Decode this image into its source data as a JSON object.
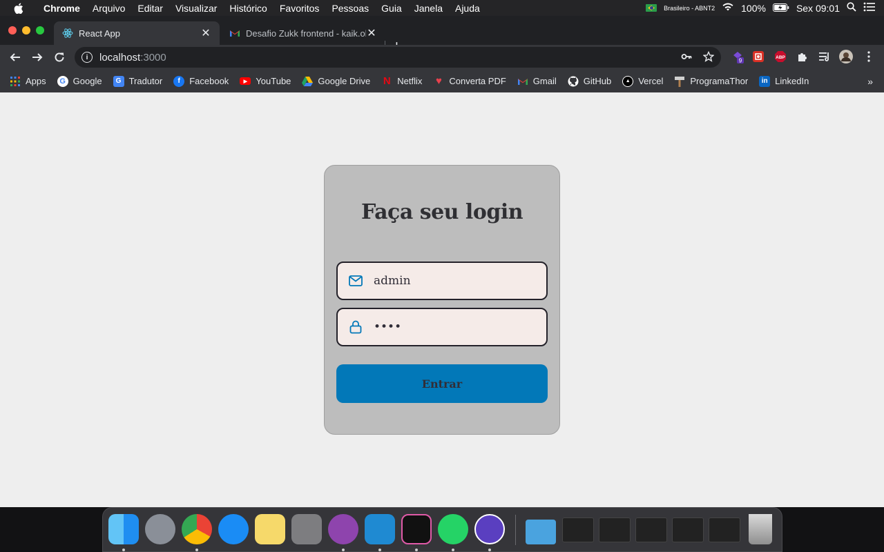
{
  "menubar": {
    "app": "Chrome",
    "items": [
      "Arquivo",
      "Editar",
      "Visualizar",
      "Histórico",
      "Favoritos",
      "Pessoas",
      "Guia",
      "Janela",
      "Ajuda"
    ],
    "keyboard": "Brasileiro - ABNT2",
    "battery": "100%",
    "clock": "Sex 09:01"
  },
  "tabs": [
    {
      "title": "React App",
      "active": true
    },
    {
      "title": "Desafio Zukk frontend - kaik.ol",
      "active": false
    }
  ],
  "address": {
    "host": "localhost",
    "port": ":3000"
  },
  "extensions": {
    "badge_count": "9",
    "abp": "ABP"
  },
  "bookmarks": [
    {
      "label": "Apps",
      "icon": "apps-grid-icon",
      "color": "#4285f4"
    },
    {
      "label": "Google",
      "icon": "google-icon",
      "color": "#ffffff"
    },
    {
      "label": "Tradutor",
      "icon": "translate-icon",
      "color": "#4285f4"
    },
    {
      "label": "Facebook",
      "icon": "facebook-icon",
      "color": "#1877f2"
    },
    {
      "label": "YouTube",
      "icon": "youtube-icon",
      "color": "#ff0000"
    },
    {
      "label": "Google Drive",
      "icon": "drive-icon",
      "color": "#1fa463"
    },
    {
      "label": "Netflix",
      "icon": "netflix-icon",
      "color": "#e50914"
    },
    {
      "label": "Converta PDF",
      "icon": "pdf-heart-icon",
      "color": "#e8414d"
    },
    {
      "label": "Gmail",
      "icon": "gmail-icon",
      "color": "#ea4335"
    },
    {
      "label": "GitHub",
      "icon": "github-icon",
      "color": "#ffffff"
    },
    {
      "label": "Vercel",
      "icon": "vercel-icon",
      "color": "#000000"
    },
    {
      "label": "ProgramaThor",
      "icon": "hammer-icon",
      "color": "#cccccc"
    },
    {
      "label": "LinkedIn",
      "icon": "linkedin-icon",
      "color": "#0a66c2"
    }
  ],
  "login": {
    "title": "Faça seu login",
    "email_value": "admin",
    "password_value": "••••",
    "submit_label": "Entrar"
  },
  "colors": {
    "page_bg": "#eeeeee",
    "card_bg": "#bdbdbd",
    "input_bg": "#f5ebe8",
    "button_bg": "#0278b8",
    "icon_accent": "#0278b8"
  },
  "dock": [
    {
      "name": "finder",
      "color": "#2b9ef3",
      "running": true
    },
    {
      "name": "launchpad",
      "color": "#8a8f98",
      "running": false
    },
    {
      "name": "chrome",
      "color": "#dddddd",
      "running": true
    },
    {
      "name": "app-store",
      "color": "#1a8cf5",
      "running": false
    },
    {
      "name": "notes",
      "color": "#f6d96a",
      "running": false
    },
    {
      "name": "system-preferences",
      "color": "#7d7d80",
      "running": false
    },
    {
      "name": "github-desktop",
      "color": "#8e44ad",
      "running": true
    },
    {
      "name": "vscode",
      "color": "#1f8ad2",
      "running": true
    },
    {
      "name": "hyper-terminal",
      "color": "#111111",
      "running": true
    },
    {
      "name": "whatsapp",
      "color": "#25d366",
      "running": true
    },
    {
      "name": "tor-browser",
      "color": "#5a3fc0",
      "running": true
    }
  ]
}
